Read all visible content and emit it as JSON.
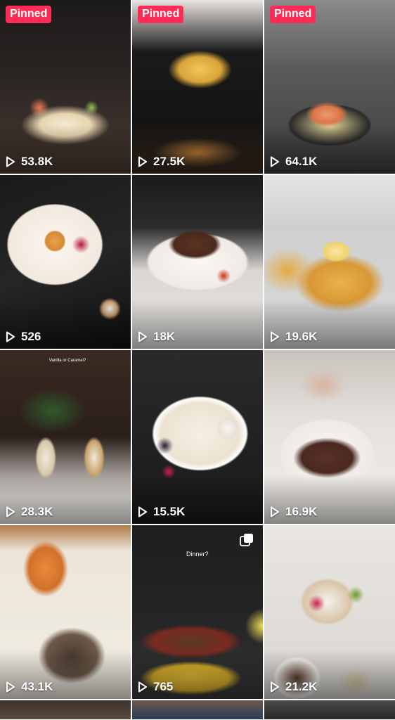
{
  "colors": {
    "pinned_badge": "#fe2c55",
    "overlay_text": "#ffffff",
    "background": "#ffffff"
  },
  "icons": {
    "play": "play-icon",
    "multi_photo": "photo-carousel-icon"
  },
  "videos": [
    {
      "pinned_label": "Pinned",
      "views": "53.8K"
    },
    {
      "pinned_label": "Pinned",
      "views": "27.5K"
    },
    {
      "pinned_label": "Pinned",
      "views": "64.1K"
    },
    {
      "views": "526"
    },
    {
      "views": "18K"
    },
    {
      "views": "19.6K"
    },
    {
      "views": "28.3K",
      "caption": "Vanilla or Caramel?"
    },
    {
      "views": "15.5K"
    },
    {
      "views": "16.9K"
    },
    {
      "views": "43.1K"
    },
    {
      "views": "765",
      "caption": "Dinner?"
    },
    {
      "views": "21.2K"
    }
  ]
}
